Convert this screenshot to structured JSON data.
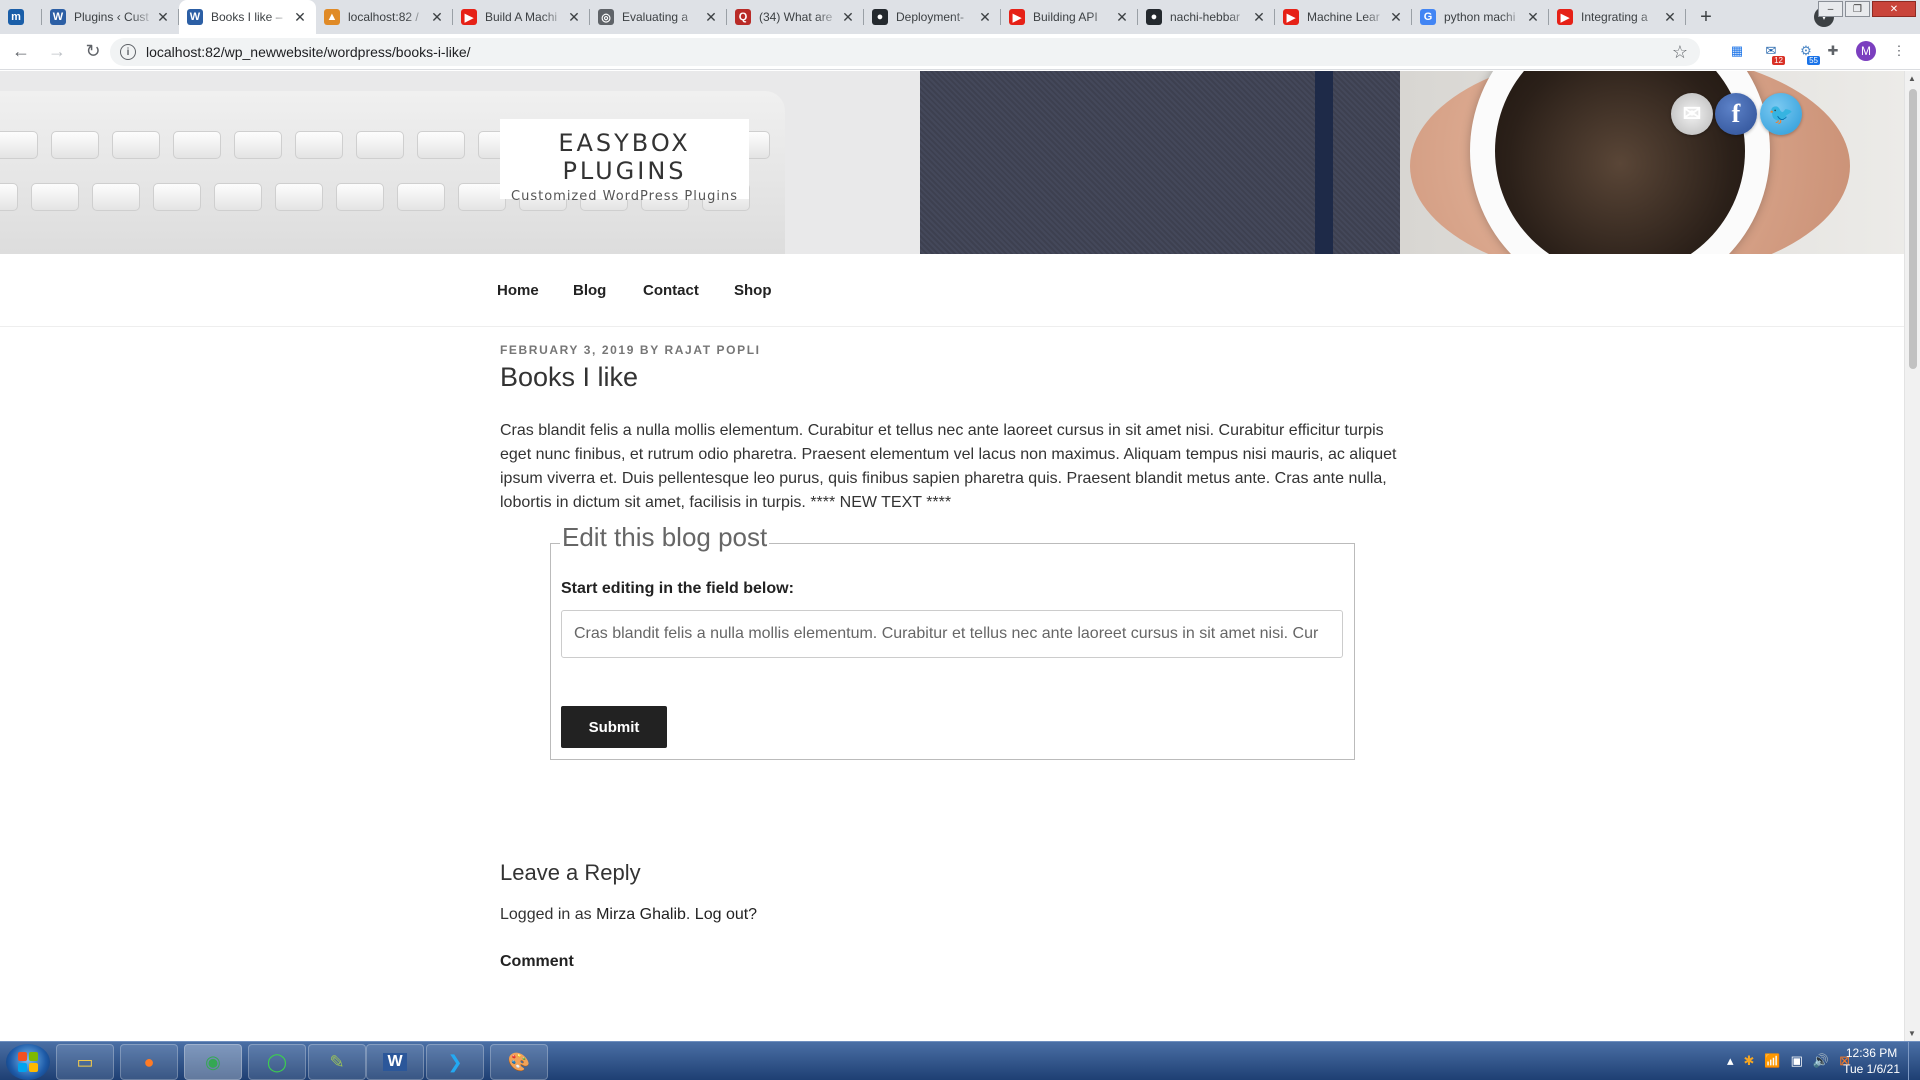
{
  "browser": {
    "tabs": [
      {
        "title": "",
        "icon": "m-icon",
        "color": "#1a5ea8",
        "glyph": "m",
        "active": false,
        "first": true
      },
      {
        "title": "Plugins ‹ Cust",
        "icon": "wordpress-icon",
        "color": "#2c5fa5",
        "glyph": "W",
        "active": false
      },
      {
        "title": "Books I like –",
        "icon": "wordpress-icon",
        "color": "#2c5fa5",
        "glyph": "W",
        "active": true
      },
      {
        "title": "localhost:82 /",
        "icon": "phpmyadmin-icon",
        "color": "#e08a26",
        "glyph": "▲",
        "active": false
      },
      {
        "title": "Build A Machi",
        "icon": "youtube-icon",
        "color": "#e62117",
        "glyph": "▶",
        "active": false
      },
      {
        "title": "Evaluating a",
        "icon": "globe-icon",
        "color": "#5f6368",
        "glyph": "◎",
        "active": false
      },
      {
        "title": "(34) What are",
        "icon": "quora-icon",
        "color": "#b92b27",
        "glyph": "Q",
        "active": false
      },
      {
        "title": "Deployment-",
        "icon": "github-icon",
        "color": "#24292e",
        "glyph": "●",
        "active": false
      },
      {
        "title": "Building API",
        "icon": "youtube-icon",
        "color": "#e62117",
        "glyph": "▶",
        "active": false
      },
      {
        "title": "nachi-hebbar",
        "icon": "github-icon",
        "color": "#24292e",
        "glyph": "●",
        "active": false
      },
      {
        "title": "Machine Lear",
        "icon": "youtube-icon",
        "color": "#e62117",
        "glyph": "▶",
        "active": false
      },
      {
        "title": "python machi",
        "icon": "google-icon",
        "color": "#4285f4",
        "glyph": "G",
        "active": false
      },
      {
        "title": "Integrating a",
        "icon": "youtube-icon",
        "color": "#e62117",
        "glyph": "▶",
        "active": false
      }
    ],
    "url": "localhost:82/wp_newwebsite/wordpress/books-i-like/",
    "extensions": {
      "mail_badge": "12",
      "ext_badge": "55",
      "profile_initial": "M"
    }
  },
  "site": {
    "title": "EASYBOX PLUGINS",
    "tagline": "Customized WordPress Plugins",
    "menu": [
      "Home",
      "Blog",
      "Contact",
      "Shop"
    ]
  },
  "post": {
    "date": "FEBRUARY 3, 2019",
    "by": "BY",
    "author": "RAJAT POPLI",
    "title": "Books I like",
    "body": "Cras blandit felis a nulla mollis elementum. Curabitur et tellus nec ante laoreet cursus in sit amet nisi. Curabitur efficitur turpis eget nunc finibus, et rutrum odio pharetra. Praesent elementum vel lacus non maximus. Aliquam tempus nisi mauris, ac aliquet ipsum viverra et. Duis pellentesque leo purus, quis finibus sapien pharetra quis. Praesent blandit metus ante. Cras ante nulla, lobortis in dictum sit amet, facilisis in turpis. **** NEW TEXT ****"
  },
  "edit_form": {
    "legend": "Edit this blog post",
    "label": "Start editing in the field below:",
    "value": "Cras blandit felis a nulla mollis elementum. Curabitur et tellus nec ante laoreet cursus in sit amet nisi. Cur",
    "submit": "Submit"
  },
  "reply": {
    "title": "Leave a Reply",
    "logged_prefix": "Logged in as",
    "user": "Mirza Ghalib",
    "logout": "Log out?",
    "comment_label": "Comment"
  },
  "taskbar": {
    "time": "12:36 PM",
    "date": "Tue 1/6/21"
  }
}
